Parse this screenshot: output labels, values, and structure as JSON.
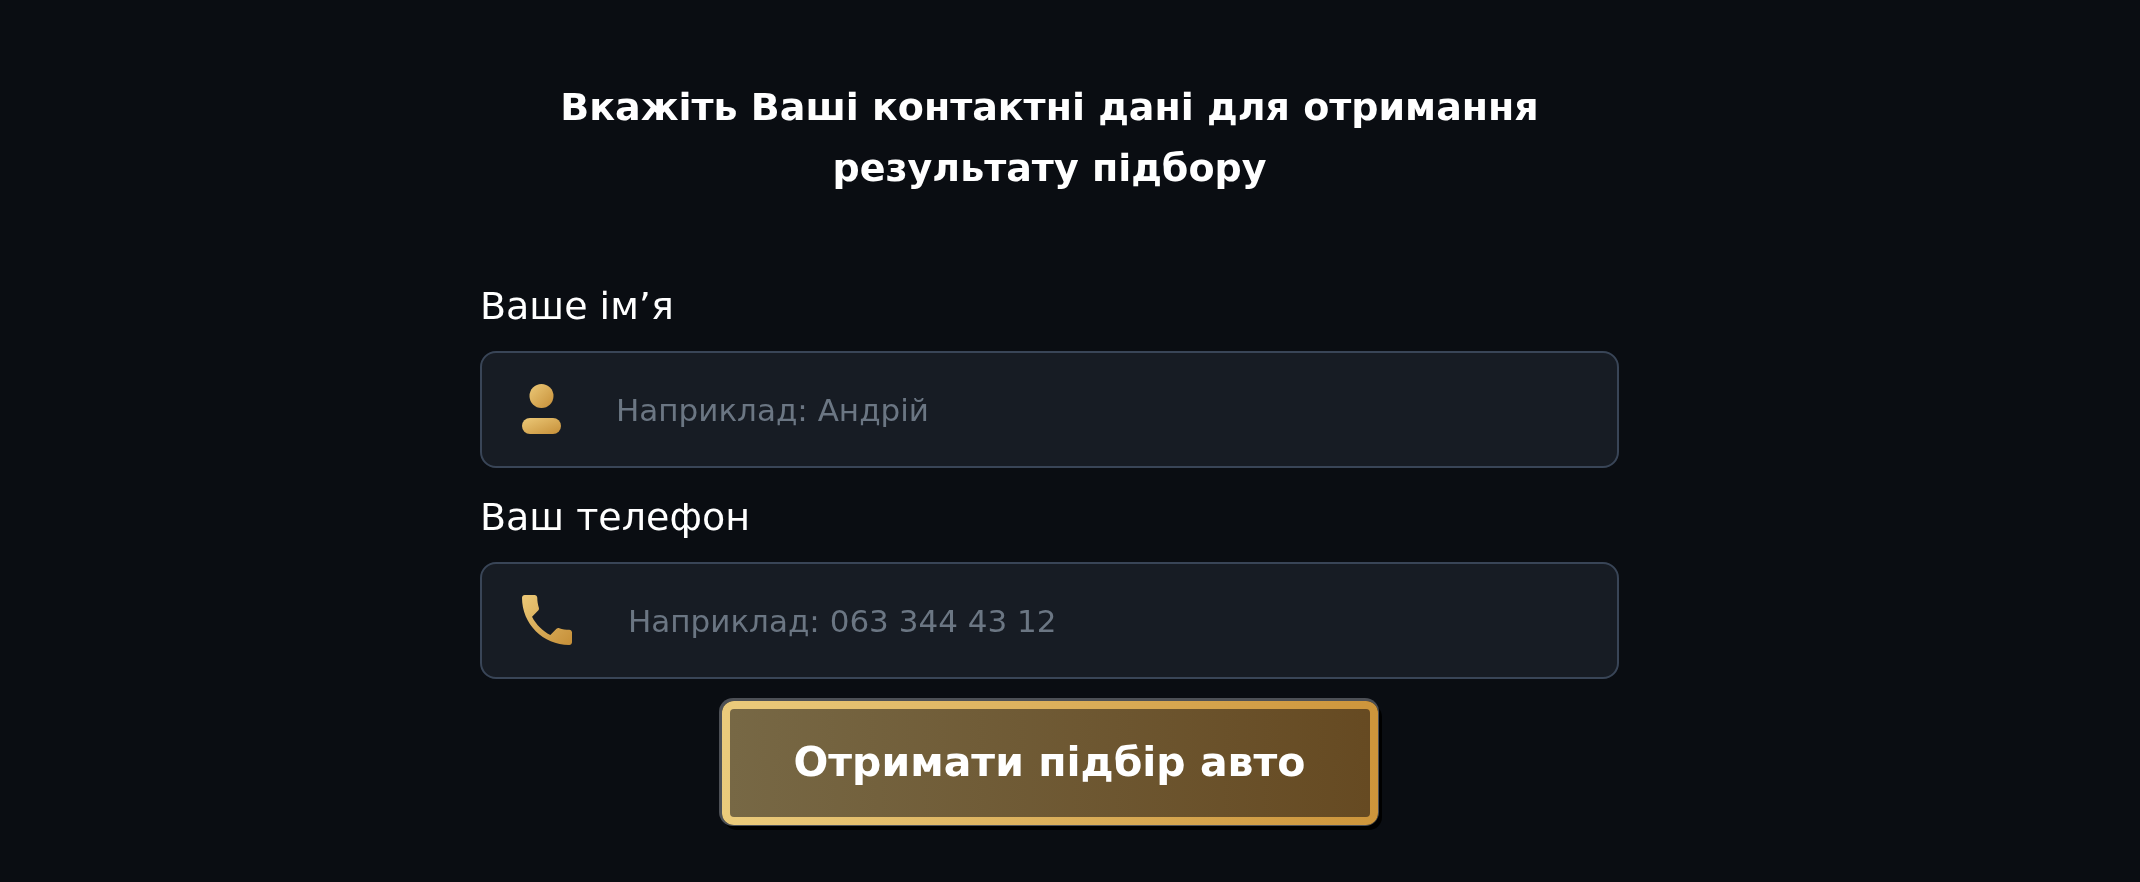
{
  "heading": "Вкажіть Ваші контактні дані для отримання результату підбору",
  "fields": [
    {
      "kind": "name",
      "label": "Ваше ім’я",
      "placeholder": "Наприклад: Андрій"
    },
    {
      "kind": "phone",
      "label": "Ваш телефон",
      "placeholder": "Наприклад: 063 344 43 12"
    }
  ],
  "submit_button": {
    "label": "Отримати підбір авто"
  }
}
